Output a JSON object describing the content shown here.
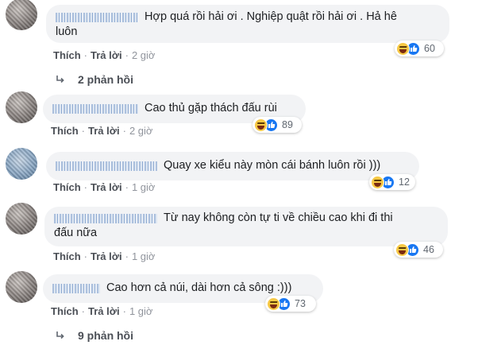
{
  "comments": [
    {
      "text_line1": "Hợp quá rồi hải ơi . Nghiệp quật rồi hải ơi . Hả hê",
      "text_line2": "luôn",
      "like_label": "Thích",
      "reply_label": "Trả lời",
      "time": "2 giờ",
      "reaction_count": "60"
    },
    {
      "text_line1": "Cao thủ gặp thách đấu rùi",
      "like_label": "Thích",
      "reply_label": "Trả lời",
      "time": "2 giờ",
      "reaction_count": "89"
    },
    {
      "text_line1": "Quay xe kiểu này mòn cái bánh luôn rồi )))",
      "like_label": "Thích",
      "reply_label": "Trả lời",
      "time": "1 giờ",
      "reaction_count": "12"
    },
    {
      "text_line1": "Từ nay không còn tự ti về chiều cao khi đi thi",
      "text_line2": "đấu nữa",
      "like_label": "Thích",
      "reply_label": "Trả lời",
      "time": "1 giờ",
      "reaction_count": "46"
    },
    {
      "text_line1": "Cao hơn cả núi, dài hơn cả sông :)))",
      "like_label": "Thích",
      "reply_label": "Trả lời",
      "time": "1 giờ",
      "reaction_count": "73"
    }
  ],
  "replies": [
    {
      "label": "2 phản hồi"
    },
    {
      "label": "9 phản hồi"
    }
  ],
  "separator": "·",
  "icons": {
    "reaction_primary": "haha-emoji-icon",
    "reaction_secondary": "like-thumb-icon",
    "reply_arrow": "reply-arrow-icon"
  },
  "colors": {
    "bubble": "#f2f3f5",
    "link": "#4b4f56",
    "meta": "#90949c",
    "like_blue": "#1877f2"
  }
}
